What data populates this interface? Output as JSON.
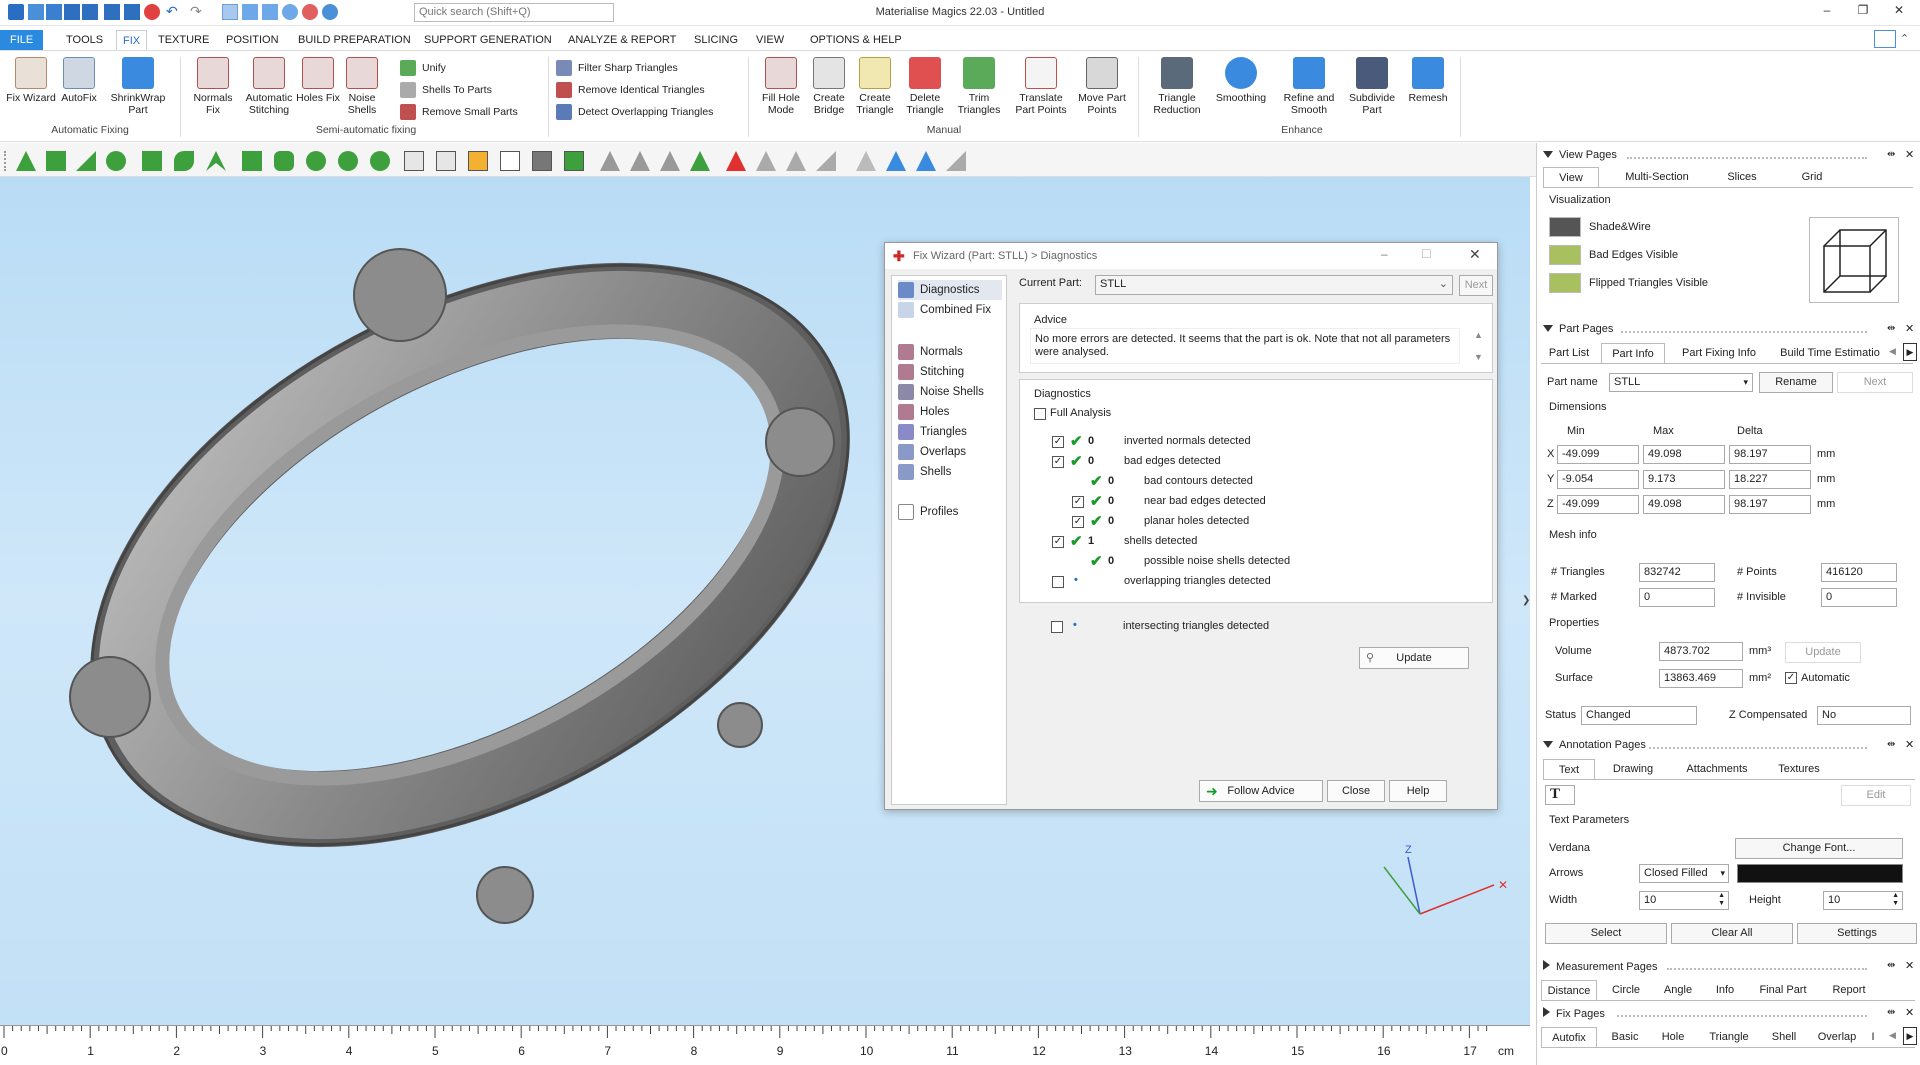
{
  "titlebar": {
    "title": "Materialise Magics 22.03 - Untitled",
    "search_placeholder": "Quick search (Shift+Q)",
    "minimize": "–",
    "maximize": "❐",
    "close": "✕"
  },
  "menu": {
    "file": "FILE",
    "tabs": [
      "TOOLS",
      "FIX",
      "TEXTURE",
      "POSITION",
      "BUILD PREPARATION",
      "SUPPORT GENERATION",
      "ANALYZE & REPORT",
      "SLICING",
      "VIEW",
      "OPTIONS & HELP"
    ],
    "active": "FIX"
  },
  "ribbon": {
    "auto_fixing": {
      "label": "Automatic Fixing",
      "buttons": [
        "Fix Wizard",
        "AutoFix",
        "ShrinkWrap Part"
      ]
    },
    "semi_auto": {
      "label": "Semi-automatic fixing",
      "buttons": [
        "Normals Fix",
        "Automatic Stitching",
        "Holes Fix",
        "Noise Shells"
      ],
      "small": [
        "Unify",
        "Shells To Parts",
        "Remove Small Parts"
      ]
    },
    "triangles": [
      "Filter Sharp Triangles",
      "Remove Identical Triangles",
      "Detect Overlapping Triangles"
    ],
    "manual": {
      "label": "Manual",
      "buttons": [
        "Fill Hole Mode",
        "Create Bridge",
        "Create Triangle",
        "Delete Triangle",
        "Trim Triangles",
        "Translate Part Points",
        "Move Part Points"
      ]
    },
    "enhance": {
      "label": "Enhance",
      "buttons": [
        "Triangle Reduction",
        "Smoothing",
        "Refine and Smooth",
        "Subdivide Part",
        "Remesh"
      ]
    }
  },
  "dialog": {
    "title": "Fix Wizard (Part: STLL) > Diagnostics",
    "nav": [
      "Diagnostics",
      "Combined Fix",
      "Normals",
      "Stitching",
      "Noise Shells",
      "Holes",
      "Triangles",
      "Overlaps",
      "Shells",
      "Profiles"
    ],
    "current_part_label": "Current Part:",
    "current_part": "STLL",
    "next": "Next",
    "advice_label": "Advice",
    "advice_text": "No more errors are detected. It seems that the part is ok. Note that not all parameters were analysed.",
    "diagnostics_label": "Diagnostics",
    "full_analysis": "Full Analysis",
    "rows": [
      {
        "count": "0",
        "text": "inverted normals detected"
      },
      {
        "count": "0",
        "text": "bad edges detected"
      },
      {
        "count": "0",
        "text": "bad contours detected"
      },
      {
        "count": "0",
        "text": "near bad edges detected"
      },
      {
        "count": "0",
        "text": "planar holes detected"
      },
      {
        "count": "1",
        "text": "shells detected"
      },
      {
        "count": "0",
        "text": "possible noise shells detected"
      },
      {
        "count": "",
        "text": "overlapping triangles detected"
      },
      {
        "count": "",
        "text": "intersecting triangles detected"
      }
    ],
    "update": "Update",
    "follow_advice": "Follow Advice",
    "close": "Close",
    "help": "Help"
  },
  "view_pages": {
    "title": "View Pages",
    "tabs": [
      "View",
      "Multi-Section",
      "Slices",
      "Grid"
    ],
    "visualization": "Visualization",
    "items": [
      "Shade&Wire",
      "Bad Edges Visible",
      "Flipped Triangles Visible"
    ]
  },
  "part_pages": {
    "title": "Part Pages",
    "tabs": [
      "Part List",
      "Part Info",
      "Part Fixing Info",
      "Build Time Estimatio"
    ],
    "part_name_label": "Part name",
    "part_name": "STLL",
    "rename": "Rename",
    "next": "Next",
    "dimensions": "Dimensions",
    "cols": [
      "Min",
      "Max",
      "Delta"
    ],
    "axes": [
      "X",
      "Y",
      "Z"
    ],
    "min": [
      "-49.099",
      "-9.054",
      "-49.099"
    ],
    "max": [
      "49.098",
      "9.173",
      "49.098"
    ],
    "delta": [
      "98.197",
      "18.227",
      "98.197"
    ],
    "unit": "mm",
    "mesh_info": "Mesh info",
    "triangles_label": "# Triangles",
    "triangles": "832742",
    "points_label": "# Points",
    "points": "416120",
    "marked_label": "# Marked",
    "marked": "0",
    "invisible_label": "# Invisible",
    "invisible": "0",
    "properties": "Properties",
    "volume_label": "Volume",
    "volume": "4873.702",
    "volume_unit": "mm³",
    "surface_label": "Surface",
    "surface": "13863.469",
    "surface_unit": "mm²",
    "update": "Update",
    "automatic": "Automatic",
    "status_label": "Status",
    "status": "Changed",
    "zcomp_label": "Z Compensated",
    "zcomp": "No"
  },
  "annotation_pages": {
    "title": "Annotation Pages",
    "tabs": [
      "Text",
      "Drawing",
      "Attachments",
      "Textures"
    ],
    "edit": "Edit",
    "text_params": "Text Parameters",
    "font": "Verdana",
    "change_font": "Change Font...",
    "arrows_label": "Arrows",
    "arrows": "Closed Filled",
    "width_label": "Width",
    "width": "10",
    "height_label": "Height",
    "height": "10",
    "select": "Select",
    "clear_all": "Clear All",
    "settings": "Settings"
  },
  "measurement_pages": {
    "title": "Measurement Pages",
    "tabs": [
      "Distance",
      "Circle",
      "Angle",
      "Info",
      "Final Part",
      "Report"
    ]
  },
  "fix_pages": {
    "title": "Fix Pages",
    "tabs": [
      "Autofix",
      "Basic",
      "Hole",
      "Triangle",
      "Shell",
      "Overlap",
      "I"
    ]
  },
  "ruler": {
    "ticks": [
      "0",
      "1",
      "2",
      "3",
      "4",
      "5",
      "6",
      "7",
      "8",
      "9",
      "10",
      "11",
      "12",
      "13",
      "14",
      "15",
      "16",
      "17"
    ],
    "unit": "cm"
  },
  "colors": {
    "accent": "#2a8ae0",
    "viewport": "#c2e0f6",
    "check": "#1a9a2a"
  }
}
